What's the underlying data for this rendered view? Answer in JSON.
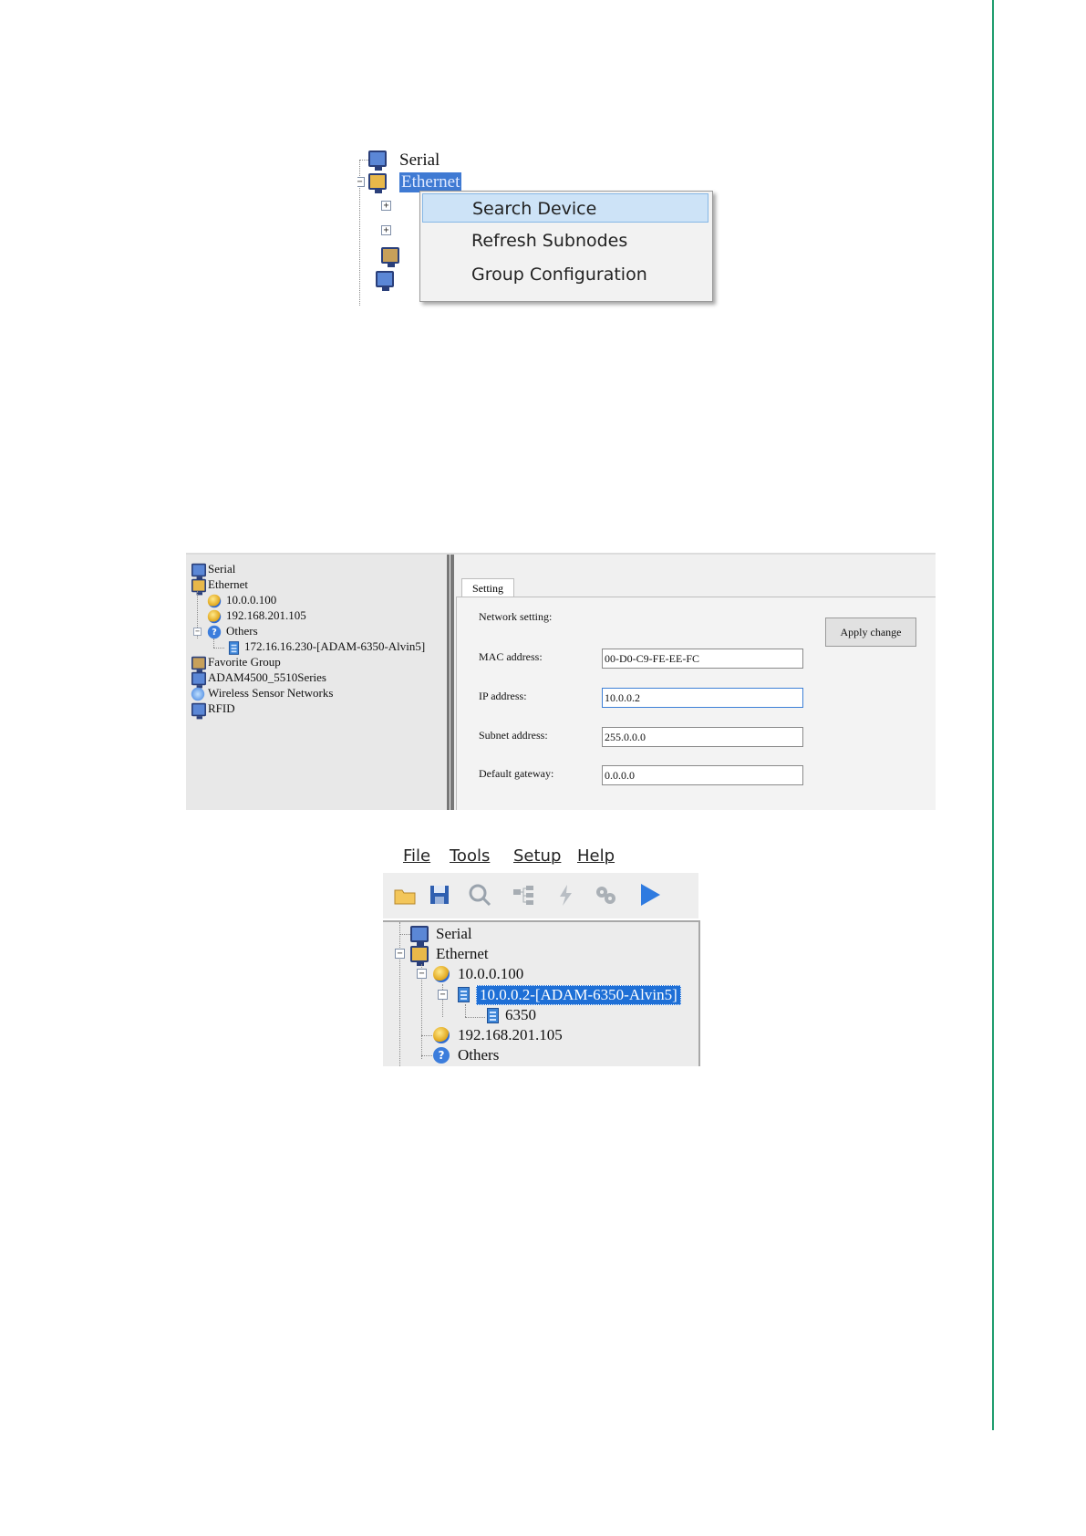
{
  "fig1": {
    "tree": {
      "serial": "Serial",
      "ethernet": "Ethernet"
    },
    "context_menu": [
      "Search Device",
      "Refresh Subnodes",
      "Group Configuration"
    ]
  },
  "fig2": {
    "tree": {
      "serial": "Serial",
      "ethernet": "Ethernet",
      "net1": "10.0.0.100",
      "net2": "192.168.201.105",
      "others": "Others",
      "device": "172.16.16.230-[ADAM-6350-Alvin5]",
      "favorite": "Favorite Group",
      "adam4500": "ADAM4500_5510Series",
      "wsn": "Wireless Sensor Networks",
      "rfid": "RFID"
    },
    "tab": "Setting",
    "network_setting_label": "Network setting:",
    "apply_button": "Apply change",
    "fields": {
      "mac_label": "MAC address:",
      "mac_value": "00-D0-C9-FE-EE-FC",
      "ip_label": "IP address:",
      "ip_value": "10.0.0.2",
      "subnet_label": "Subnet address:",
      "subnet_value": "255.0.0.0",
      "gateway_label": "Default gateway:",
      "gateway_value": "0.0.0.0"
    }
  },
  "fig3": {
    "menu": [
      "File",
      "Tools",
      "Setup",
      "Help"
    ],
    "toolbar_icons": [
      "open-folder-icon",
      "save-icon",
      "search-icon",
      "network-icon",
      "flash-icon",
      "gears-icon",
      "play-icon"
    ],
    "tree": {
      "serial": "Serial",
      "ethernet": "Ethernet",
      "net1": "10.0.0.100",
      "device": "10.0.0.2-[ADAM-6350-Alvin5]",
      "module": "6350",
      "net2": "192.168.201.105",
      "others": "Others"
    }
  },
  "colors": {
    "accent_green": "#1f9d6e",
    "selection_blue": "#1e6fd6",
    "menu_highlight": "#cde3f7"
  }
}
